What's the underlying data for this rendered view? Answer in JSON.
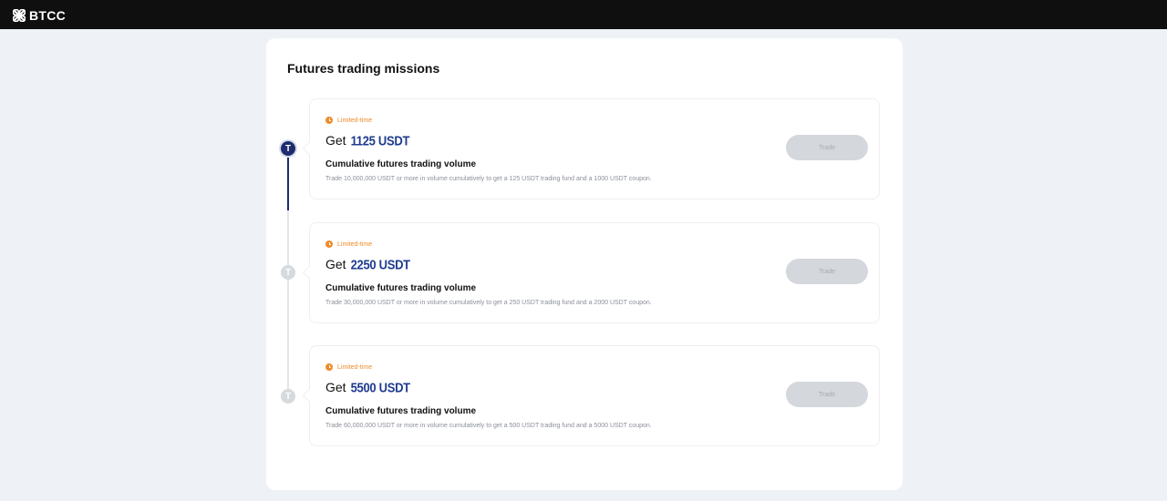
{
  "header": {
    "brand": "BTCC",
    "icon": "btcc-logo-icon"
  },
  "panel": {
    "title": "Futures trading missions"
  },
  "missions": [
    {
      "status": "Limited-time",
      "get_label": "Get",
      "amount": "1125 USDT",
      "name": "Cumulative futures trading volume",
      "description": "Trade 10,000,000 USDT or more in volume cumulatively to get a 125 USDT trading fund and a 1000 USDT coupon.",
      "button": "Trade",
      "active": true,
      "step_icon": "T"
    },
    {
      "status": "Limited-time",
      "get_label": "Get",
      "amount": "2250 USDT",
      "name": "Cumulative futures trading volume",
      "description": "Trade 30,000,000 USDT or more in volume cumulatively to get a 250 USDT trading fund and a 2000 USDT coupon.",
      "button": "Trade",
      "active": false,
      "step_icon": "T"
    },
    {
      "status": "Limited-time",
      "get_label": "Get",
      "amount": "5500 USDT",
      "name": "Cumulative futures trading volume",
      "description": "Trade 60,000,000 USDT or more in volume cumulatively to get a 500 USDT trading fund and a 5000 USDT coupon.",
      "button": "Trade",
      "active": false,
      "step_icon": "T"
    }
  ],
  "colors": {
    "accent": "#1f3b8f",
    "limited": "#f08b2a",
    "disabled_button": "#d4d7dc"
  }
}
